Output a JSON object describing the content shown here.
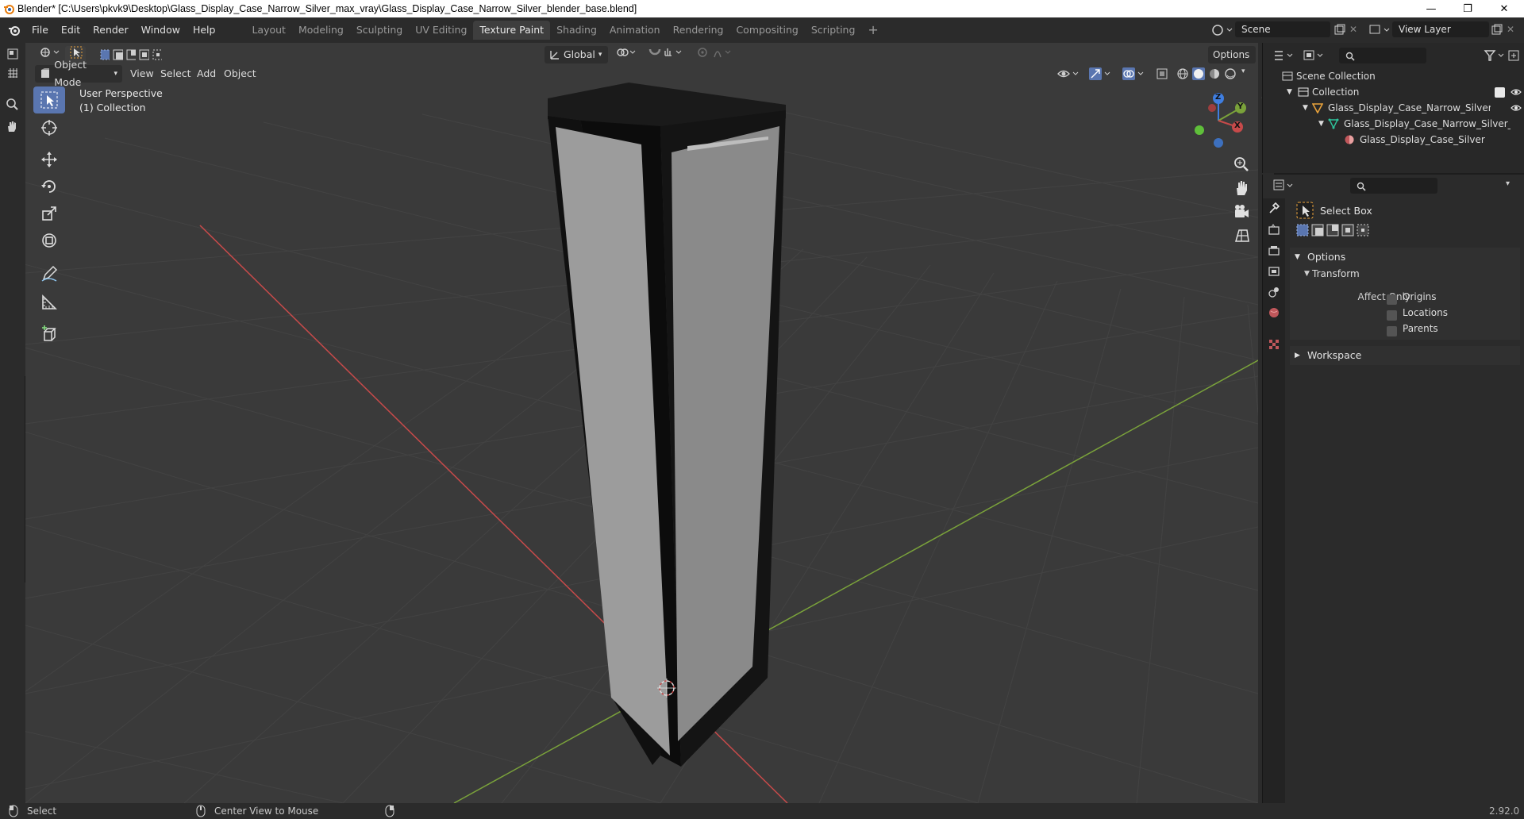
{
  "window": {
    "title": "Blender* [C:\\Users\\pkvk9\\Desktop\\Glass_Display_Case_Narrow_Silver_max_vray\\Glass_Display_Case_Narrow_Silver_blender_base.blend]",
    "minimize": "—",
    "maximize": "❐",
    "close": "✕"
  },
  "menu": {
    "items": [
      "File",
      "Edit",
      "Render",
      "Window",
      "Help"
    ]
  },
  "workspaces": {
    "tabs": [
      "Layout",
      "Modeling",
      "Sculpting",
      "UV Editing",
      "Texture Paint",
      "Shading",
      "Animation",
      "Rendering",
      "Compositing",
      "Scripting"
    ],
    "active": "Texture Paint",
    "add": "+"
  },
  "scene": {
    "name": "Scene",
    "view_layer": "View Layer"
  },
  "viewport": {
    "mode": "Object Mode",
    "menus": [
      "View",
      "Select",
      "Add",
      "Object"
    ],
    "transform_orientation": "Global",
    "options": "Options",
    "overlay_title": "User Perspective",
    "overlay_sub": "(1) Collection",
    "gizmo": {
      "x": "X",
      "y": "Y",
      "z": "Z"
    }
  },
  "outliner": {
    "root": "Scene Collection",
    "collection": "Collection",
    "object": "Glass_Display_Case_Narrow_Silver_obj_",
    "mesh": "Glass_Display_Case_Narrow_Silver_",
    "material": "Glass_Display_Case_Silver"
  },
  "properties": {
    "tool_name": "Select Box",
    "options_label": "Options",
    "transform_label": "Transform",
    "affect_only": "Affect Only",
    "checkboxes": [
      "Origins",
      "Locations",
      "Parents"
    ],
    "workspace_label": "Workspace"
  },
  "status": {
    "select": "Select",
    "center_view": "Center View to Mouse",
    "version": "2.92.0"
  },
  "colors": {
    "accent": "#5a76b0",
    "axis_x": "#c74a4a",
    "axis_y": "#7aa23a",
    "axis_z": "#3f7ee0",
    "viewport_bg": "#3a3a3a"
  }
}
